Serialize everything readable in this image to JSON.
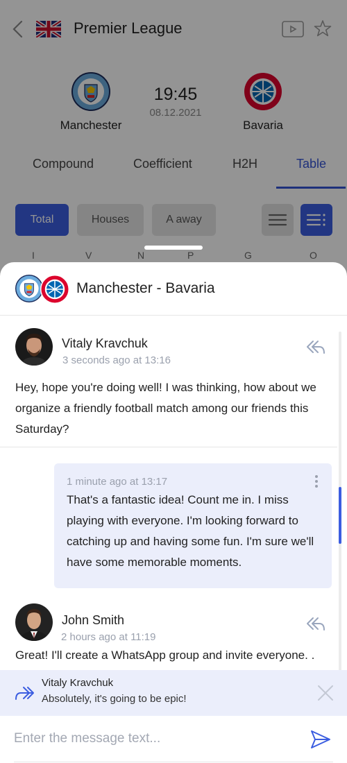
{
  "match": {
    "league": "Premier League",
    "home": "Manchester",
    "away": "Bavaria",
    "time": "19:45",
    "date": "08.12.2021"
  },
  "tabs": [
    {
      "label": "Compound"
    },
    {
      "label": "Coefficient"
    },
    {
      "label": "H2H"
    },
    {
      "label": "Table",
      "active": true
    }
  ],
  "filters": [
    {
      "label": "Total",
      "active": true
    },
    {
      "label": "Houses"
    },
    {
      "label": "A away"
    }
  ],
  "table_columns": [
    "I",
    "V",
    "N",
    "P",
    "G",
    "O"
  ],
  "chat": {
    "title": "Manchester - Bavaria",
    "messages": [
      {
        "author": "Vitaly Kravchuk",
        "timestamp": "3 seconds ago at 13:16",
        "text": "Hey, hope you're doing well! I was thinking, how about we organize a friendly football match among our friends this Saturday?"
      },
      {
        "own": true,
        "timestamp": "1 minute ago at 13:17",
        "text": "That's a fantastic idea! Count me in. I miss playing with everyone.  I'm looking forward to catching up and having some fun. I'm sure we'll have some memorable moments."
      },
      {
        "author": "John Smith",
        "timestamp": "2 hours ago at 11:19",
        "text": "Great! I'll create a WhatsApp group and invite everyone. ."
      }
    ],
    "reply_to": {
      "author": "Vitaly Kravchuk",
      "text": "Absolutely, it's going to be epic!"
    },
    "composer": {
      "placeholder": "Enter the message text...",
      "value": ""
    }
  },
  "colors": {
    "accent": "#3b5de0",
    "own_bubble": "#ebeefb",
    "timestamp": "#9aa0ad"
  },
  "icons": [
    "back-chevron-icon",
    "uk-flag-icon",
    "tv-icon",
    "star-icon",
    "list-view-icon",
    "detailed-list-icon",
    "reply-icon",
    "more-vertical-icon",
    "forward-reply-icon",
    "close-icon",
    "send-icon"
  ]
}
